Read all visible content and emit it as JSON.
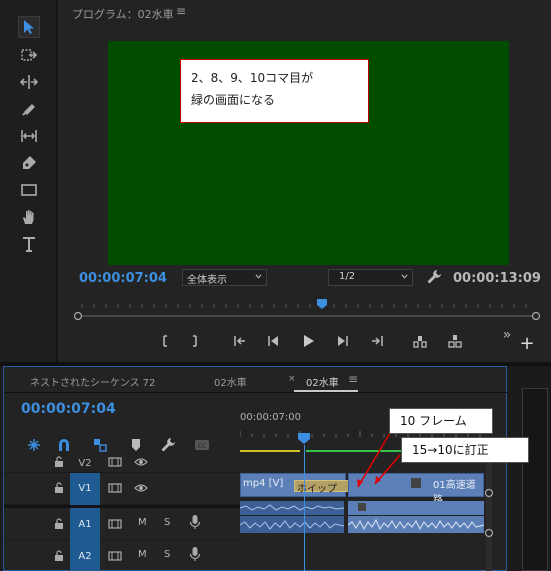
{
  "tools": [
    "selection-tool",
    "track-select-tool",
    "ripple-edit-tool",
    "razor-tool",
    "slip-tool",
    "pen-tool",
    "rectangle-tool",
    "hand-tool",
    "type-tool"
  ],
  "monitor": {
    "title": "プログラム：02水車",
    "menu_glyph": "≡",
    "note_line1": "2、8、9、10コマ目が",
    "note_line2": "緑の画面になる",
    "timecode_current": "00:00:07:04",
    "fit_select": "全体表示",
    "resolution_select": "1/2",
    "timecode_duration": "00:00:13:09"
  },
  "timeline": {
    "tabs": [
      "ネストされたシーケンス 72",
      "02水車",
      "02水車"
    ],
    "tab_close": "×",
    "tab_menu": "≡",
    "timecode": "00:00:07:04",
    "ruler_time": "00:00:07:00",
    "tracks": [
      {
        "label": "V2",
        "active": false
      },
      {
        "label": "V1",
        "active": true
      },
      {
        "label": "A1",
        "active": true
      },
      {
        "label": "A2",
        "active": true
      }
    ],
    "track_m": "M",
    "track_s": "S",
    "clip_v1_left": "mp4 [V]",
    "clip_v1_overlay": "ホイップ",
    "clip_v1_right": "01高速道路"
  },
  "callouts": {
    "frames": "10 フレーム",
    "correction": "15→10に訂正"
  },
  "colors": {
    "accent_blue": "#3d8fe0",
    "video_green": "#004d00",
    "clip_blue": "#5b7fb6",
    "track_active": "#1f5a92"
  }
}
